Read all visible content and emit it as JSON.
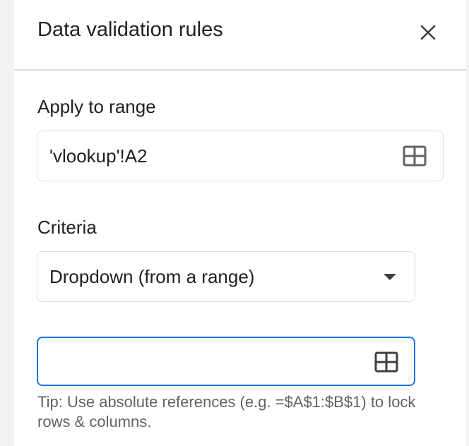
{
  "panel": {
    "title": "Data validation rules"
  },
  "apply_to_range": {
    "label": "Apply to range",
    "value": "'vlookup'!A2",
    "icon": "grid-range-icon"
  },
  "criteria": {
    "label": "Criteria",
    "selected": "Dropdown (from a range)",
    "range_input": {
      "value": "",
      "placeholder": ""
    },
    "tip": "Tip: Use absolute references (e.g. =$A$1:$B$1) to lock rows & columns."
  },
  "colors": {
    "accent": "#1a73e8",
    "border": "#dadce0",
    "text": "#202124",
    "muted": "#5f6368"
  }
}
